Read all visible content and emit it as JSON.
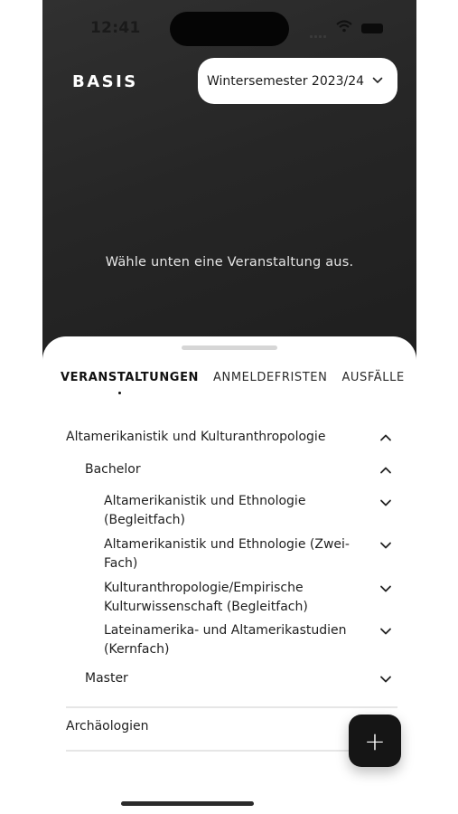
{
  "status_bar": {
    "time": "12:41"
  },
  "header": {
    "brand": "BASIS",
    "semester_select": {
      "selected": "Wintersemester 2023/24"
    }
  },
  "hero": {
    "hint": "Wähle unten eine Veranstaltung aus."
  },
  "tabs": [
    {
      "label": "VERANSTALTUNGEN",
      "active": true
    },
    {
      "label": "ANMELDEFRISTEN",
      "active": false
    },
    {
      "label": "AUSFÄLLE",
      "active": false
    }
  ],
  "tree": {
    "faculty_1": "Altamerikanistik und Kulturanthropologie",
    "bachelor": "Bachelor",
    "programs": [
      {
        "line1": "Altamerikanistik und Ethnologie",
        "line2": "(Begleitfach)"
      },
      {
        "line1": "Altamerikanistik und Ethnologie (Zwei-",
        "line2": "Fach)"
      },
      {
        "line1": "Kulturanthropologie/Empirische",
        "line2": "Kulturwissenschaft (Begleitfach)"
      },
      {
        "line1": "Lateinamerika- und Altamerikastudien",
        "line2": "(Kernfach)"
      }
    ],
    "master": "Master",
    "faculty_2": "Archäologien"
  },
  "fab": {
    "label": "+"
  }
}
